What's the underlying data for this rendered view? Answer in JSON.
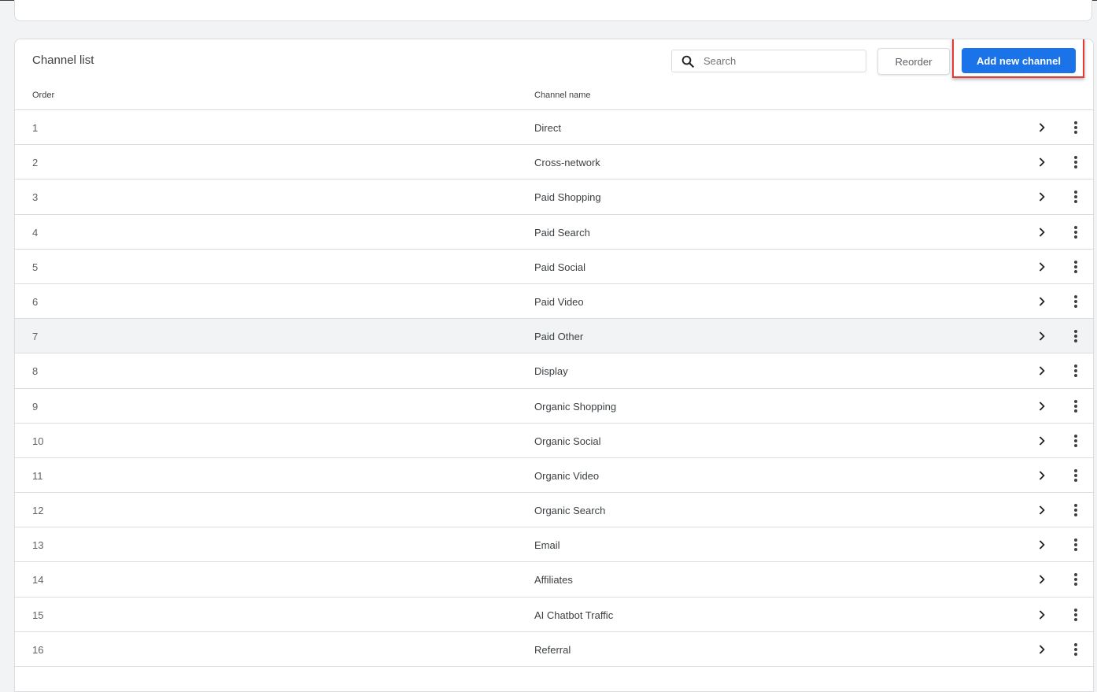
{
  "card": {
    "title": "Channel list",
    "search": {
      "placeholder": "Search",
      "value": ""
    },
    "reorder_label": "Reorder",
    "add_label": "Add new channel"
  },
  "table": {
    "columns": [
      "Order",
      "Channel name"
    ],
    "rows": [
      {
        "order": "1",
        "name": "Direct"
      },
      {
        "order": "2",
        "name": "Cross-network"
      },
      {
        "order": "3",
        "name": "Paid Shopping"
      },
      {
        "order": "4",
        "name": "Paid Search"
      },
      {
        "order": "5",
        "name": "Paid Social"
      },
      {
        "order": "6",
        "name": "Paid Video"
      },
      {
        "order": "7",
        "name": "Paid Other"
      },
      {
        "order": "8",
        "name": "Display"
      },
      {
        "order": "9",
        "name": "Organic Shopping"
      },
      {
        "order": "10",
        "name": "Organic Social"
      },
      {
        "order": "11",
        "name": "Organic Video"
      },
      {
        "order": "12",
        "name": "Organic Search"
      },
      {
        "order": "13",
        "name": "Email"
      },
      {
        "order": "14",
        "name": "Affiliates"
      },
      {
        "order": "15",
        "name": "AI Chatbot Traffic"
      },
      {
        "order": "16",
        "name": "Referral"
      }
    ],
    "hovered_row_index": 6
  },
  "icons": {
    "search": "search-icon",
    "row_open": "chevron-right-icon",
    "row_menu": "more-vert-icon"
  },
  "colors": {
    "primary": "#1a73e8",
    "highlight": "#e53935",
    "background": "#f1f3f4"
  }
}
